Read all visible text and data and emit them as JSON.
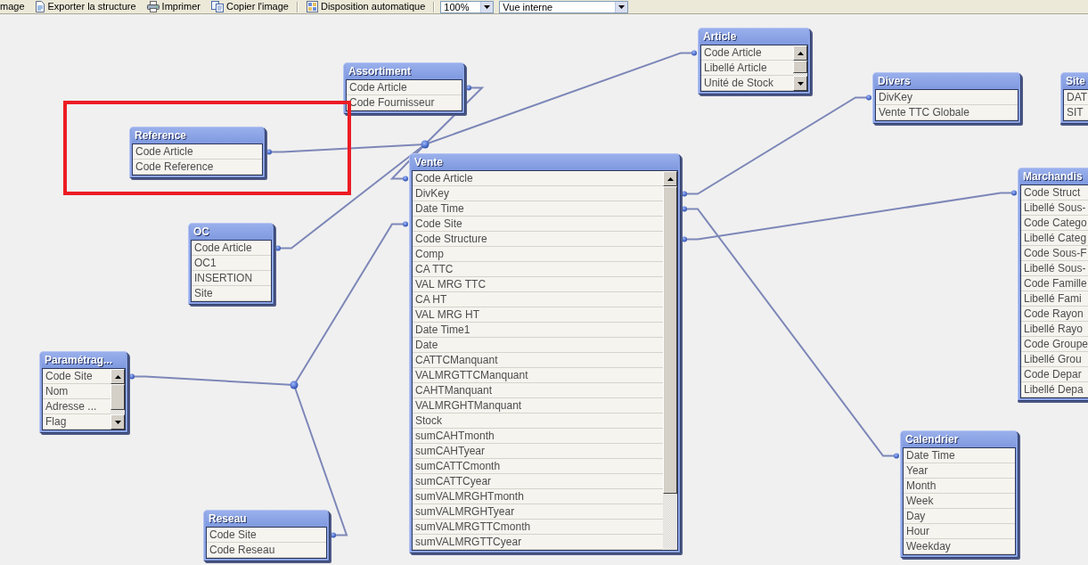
{
  "toolbar": {
    "buttons": [
      {
        "label": "mage"
      },
      {
        "label": "Exporter la structure"
      },
      {
        "label": "Imprimer"
      },
      {
        "label": "Copier l'image"
      },
      {
        "label": "Disposition automatique"
      }
    ],
    "zoom": {
      "value": "100%"
    },
    "view": {
      "value": "Vue interne"
    }
  },
  "tables": [
    {
      "title": "Assortiment",
      "fields": [
        "Code Article",
        "Code Fournisseur"
      ]
    },
    {
      "title": "Article",
      "fields": [
        "Code Article",
        "Libellé Article",
        "Unité de Stock"
      ]
    },
    {
      "title": "Divers",
      "fields": [
        "DivKey",
        "Vente TTC Globale"
      ]
    },
    {
      "title": "Site",
      "fields": [
        "DAT",
        "SIT"
      ]
    },
    {
      "title": "Reference",
      "fields": [
        "Code Article",
        "Code Reference"
      ]
    },
    {
      "title": "OC",
      "fields": [
        "Code Article",
        "OC1",
        "INSERTION",
        "Site"
      ]
    },
    {
      "title": "Paramétrag...",
      "fields": [
        "Code Site",
        "Nom",
        "Adresse ...",
        "Flag"
      ]
    },
    {
      "title": "Reseau",
      "fields": [
        "Code Site",
        "Code Reseau"
      ]
    },
    {
      "title": "Vente",
      "fields": [
        "Code Article",
        "DivKey",
        "Date Time",
        "Code Site",
        "Code Structure",
        "Comp",
        "CA TTC",
        "VAL MRG TTC",
        "CA HT",
        "VAL MRG HT",
        "Date Time1",
        "Date",
        "CATTCManquant",
        "VALMRGTTCManquant",
        "CAHTManquant",
        "VALMRGHTManquant",
        "Stock",
        "sumCAHTmonth",
        "sumCAHTyear",
        "sumCATTCmonth",
        "sumCATTCyear",
        "sumVALMRGHTmonth",
        "sumVALMRGHTyear",
        "sumVALMRGTTCmonth",
        "sumVALMRGTTCyear"
      ]
    },
    {
      "title": "Marchandis",
      "fields": [
        "Code Struct",
        "Libellé Sous-",
        "Code Catego",
        "Libellé Categ",
        "Code Sous-F",
        "Libellé Sous-",
        "Code Famille",
        "Libellé Fami",
        "Code Rayon",
        "Libellé Rayo",
        "Code Groupe",
        "Libellé Grou",
        "Code Depar",
        "Libellé Depa"
      ]
    },
    {
      "title": "Calendrier",
      "fields": [
        "Date Time",
        "Year",
        "Month",
        "Week",
        "Day",
        "Hour",
        "Weekday"
      ]
    }
  ]
}
